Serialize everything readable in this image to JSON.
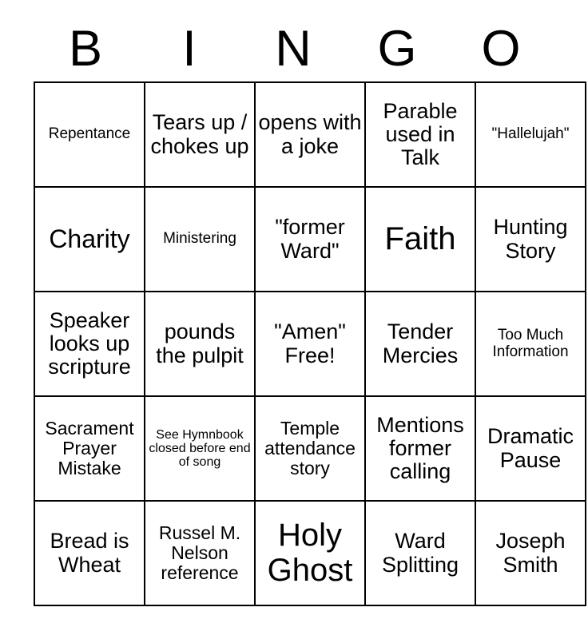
{
  "card": {
    "header_letters": [
      "B",
      "I",
      "N",
      "G",
      "O"
    ],
    "columns": 5,
    "rows": 5,
    "cells": [
      [
        {
          "text": "Repentance",
          "size": "xs"
        },
        {
          "text": "Tears up / chokes up",
          "size": "md"
        },
        {
          "text": "opens with a joke",
          "size": "md"
        },
        {
          "text": "Parable used in Talk",
          "size": "md"
        },
        {
          "text": "\"Hallelujah\"",
          "size": "xs"
        }
      ],
      [
        {
          "text": "Charity",
          "size": "lg"
        },
        {
          "text": "Ministering",
          "size": "xs"
        },
        {
          "text": "\"former Ward\"",
          "size": "md"
        },
        {
          "text": "Faith",
          "size": "xl"
        },
        {
          "text": "Hunting Story",
          "size": "md"
        }
      ],
      [
        {
          "text": "Speaker looks up scripture",
          "size": "md"
        },
        {
          "text": "pounds the pulpit",
          "size": "md"
        },
        {
          "text": "\"Amen\" Free!",
          "size": "md"
        },
        {
          "text": "Tender Mercies",
          "size": "md"
        },
        {
          "text": "Too Much Information",
          "size": "xs"
        }
      ],
      [
        {
          "text": "Sacrament Prayer Mistake",
          "size": "sm"
        },
        {
          "text": "See Hymnbook closed before end of song",
          "size": "xxs"
        },
        {
          "text": "Temple attendance story",
          "size": "sm"
        },
        {
          "text": "Mentions former calling",
          "size": "md"
        },
        {
          "text": "Dramatic Pause",
          "size": "md"
        }
      ],
      [
        {
          "text": "Bread is Wheat",
          "size": "md"
        },
        {
          "text": "Russel M. Nelson reference",
          "size": "sm"
        },
        {
          "text": "Holy Ghost",
          "size": "xl"
        },
        {
          "text": "Ward Splitting",
          "size": "md"
        },
        {
          "text": "Joseph Smith",
          "size": "md"
        }
      ]
    ]
  },
  "colors": {
    "background": "#ffffff",
    "text": "#000000",
    "grid_line": "#000000"
  }
}
